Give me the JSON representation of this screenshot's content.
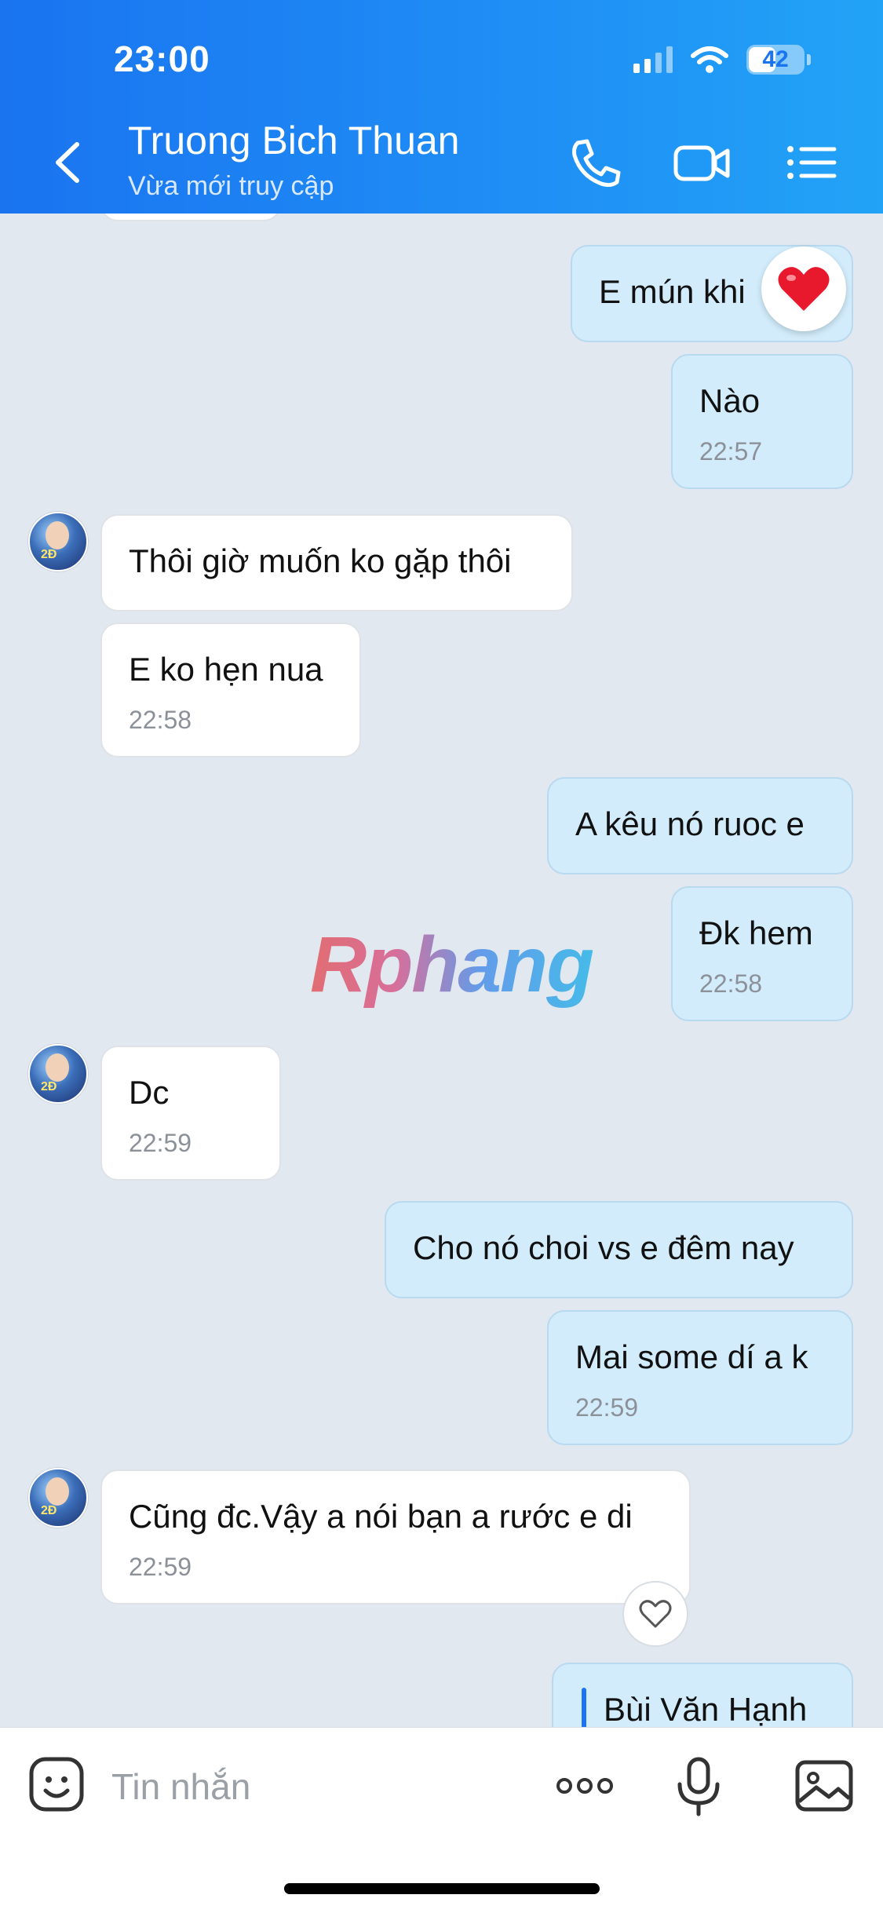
{
  "status": {
    "time": "23:00",
    "battery": "42"
  },
  "header": {
    "contact_name": "Truong Bich Thuan",
    "status_text": "Vừa mới truy cập"
  },
  "messages": [
    {
      "text": "E mún khi"
    },
    {
      "text": "Nào",
      "time": "22:57"
    },
    {
      "text": "Thôi giờ muốn ko gặp thôi"
    },
    {
      "text": "E ko hẹn nua",
      "time": "22:58"
    },
    {
      "text": "A kêu nó ruoc e"
    },
    {
      "text": "Đk hem",
      "time": "22:58"
    },
    {
      "text": "Dc",
      "time": "22:59"
    },
    {
      "text": "Cho nó choi vs e đêm nay"
    },
    {
      "text": "Mai some dí a k",
      "time": "22:59"
    },
    {
      "text": "Cũng đc.Vậy a nói bạn a rước e di",
      "time": "22:59"
    },
    {
      "reply_name": "Bùi Văn Hạnh"
    }
  ],
  "watermark": "Rphang",
  "composer": {
    "placeholder": "Tin nhắn"
  },
  "colors": {
    "header_start": "#1a74f0",
    "header_end": "#22a3f7",
    "outgoing_bubble": "#d2ecfb",
    "incoming_bubble": "#ffffff",
    "reaction_heart": "#e8192c"
  },
  "icons": [
    "back-icon",
    "phone-icon",
    "video-call-icon",
    "menu-list-icon",
    "heart-reaction-icon",
    "heart-outline-icon",
    "sticker-icon",
    "more-icon",
    "microphone-icon",
    "image-icon"
  ]
}
